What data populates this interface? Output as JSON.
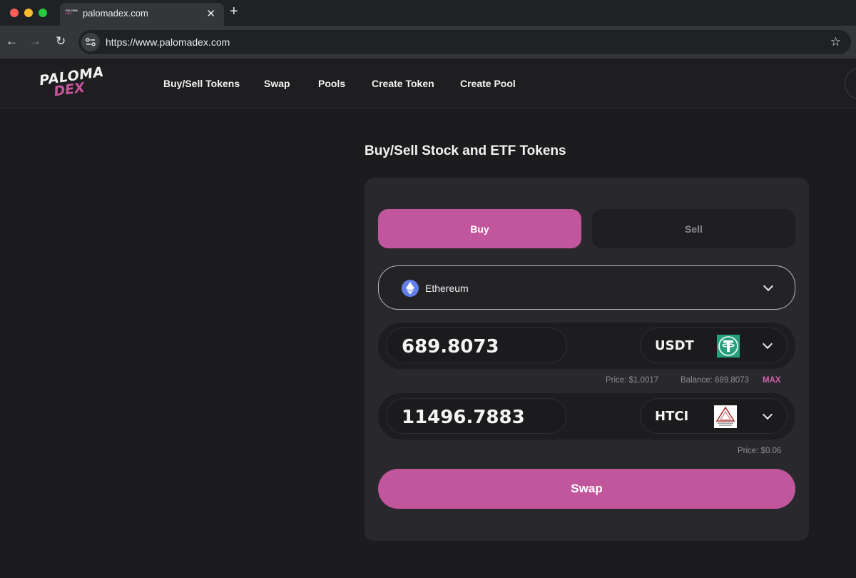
{
  "browser": {
    "tab_title": "palomadex.com",
    "favicon_text_top": "PALOMA",
    "favicon_text_bottom": "DEX",
    "close_glyph": "✕",
    "new_tab_glyph": "+",
    "back_glyph": "←",
    "forward_glyph": "→",
    "reload_glyph": "↻",
    "url": "https://www.palomadex.com",
    "bookmark_glyph": "☆"
  },
  "header": {
    "logo_top": "PALOMA",
    "logo_bottom": "DEX",
    "nav": [
      "Buy/Sell Tokens",
      "Swap",
      "Pools",
      "Create Token",
      "Create Pool"
    ]
  },
  "page": {
    "title": "Buy/Sell Stock and ETF Tokens"
  },
  "trade": {
    "buy_label": "Buy",
    "sell_label": "Sell",
    "active_mode": "Buy",
    "chain": {
      "name": "Ethereum",
      "icon": "ethereum-icon"
    },
    "from": {
      "amount": "689.8073",
      "symbol": "USDT",
      "icon": "tether-icon",
      "price": "Price: $1.0017",
      "balance": "Balance: 689.8073",
      "max_label": "MAX"
    },
    "to": {
      "amount": "11496.7883",
      "symbol": "HTCI",
      "icon": "htci-token-icon",
      "price": "Price: $0.06"
    },
    "swap_label": "Swap"
  },
  "colors": {
    "accent": "#c1569c",
    "background": "#1c1c1e",
    "card": "#29292d"
  }
}
